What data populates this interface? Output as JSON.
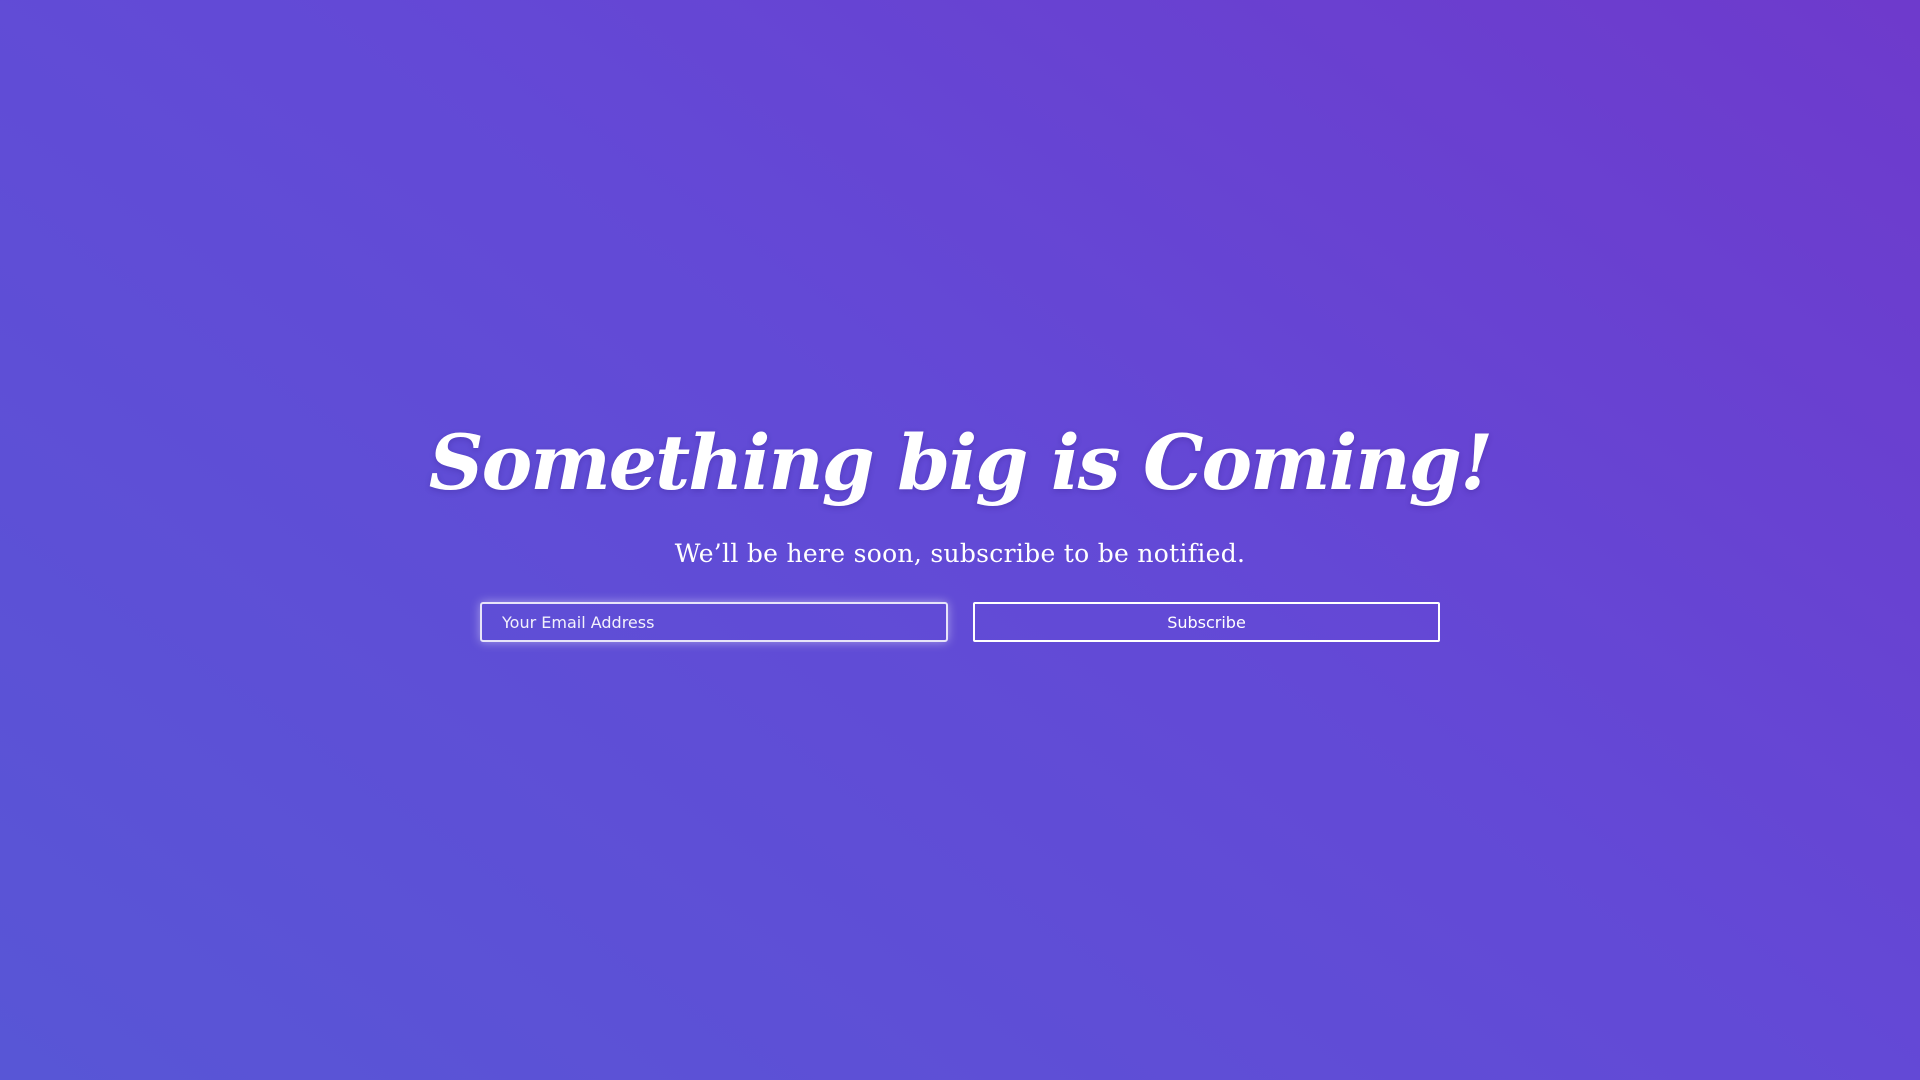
{
  "hero": {
    "headline": "Something big is Coming!",
    "tagline": "We’ll be here soon, subscribe to be notified."
  },
  "form": {
    "email_placeholder": "Your Email Address",
    "email_value": "",
    "subscribe_label": "Subscribe"
  },
  "colors": {
    "gradient_start": "#5856d6",
    "gradient_mid": "#6349d6",
    "gradient_end": "#6e3acc",
    "text": "#ffffff"
  }
}
